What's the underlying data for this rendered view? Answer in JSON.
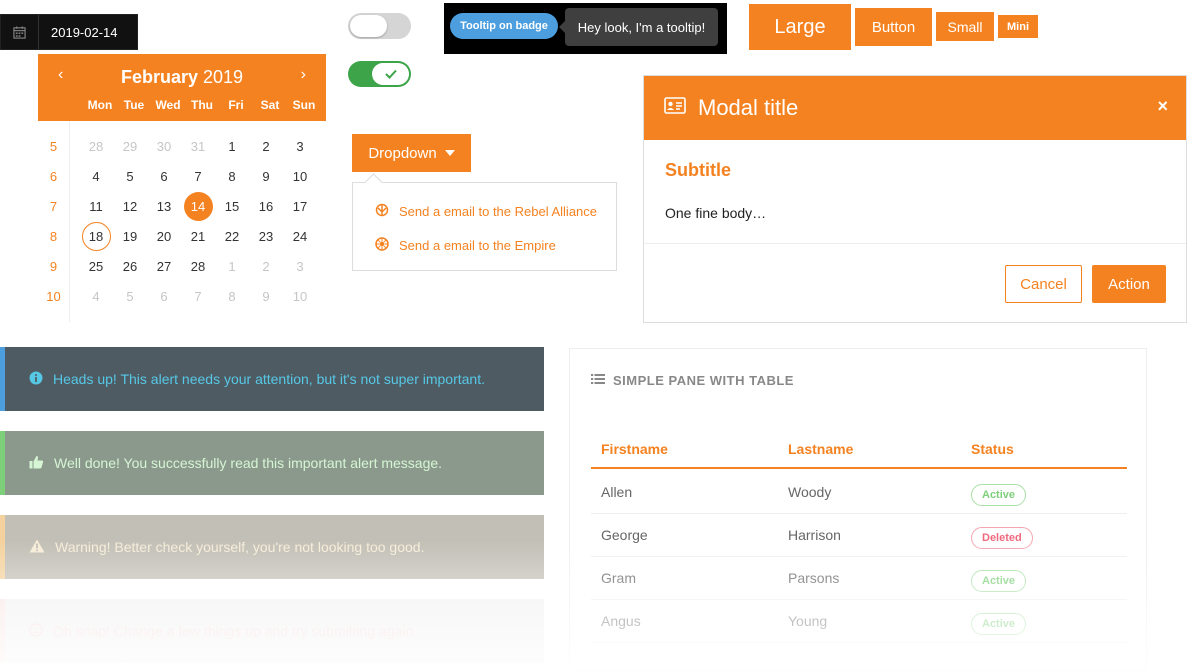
{
  "date_input": {
    "value": "2019-02-14",
    "icon": "calendar-icon"
  },
  "calendar": {
    "month": "February",
    "year": "2019",
    "weekdays": [
      "Mon",
      "Tue",
      "Wed",
      "Thu",
      "Fri",
      "Sat",
      "Sun"
    ],
    "weeks": [
      "5",
      "6",
      "7",
      "8",
      "9",
      "10"
    ],
    "days": [
      "28",
      "29",
      "30",
      "31",
      "1",
      "2",
      "3",
      "4",
      "5",
      "6",
      "7",
      "8",
      "9",
      "10",
      "11",
      "12",
      "13",
      "14",
      "15",
      "16",
      "17",
      "18",
      "19",
      "20",
      "21",
      "22",
      "23",
      "24",
      "25",
      "26",
      "27",
      "28",
      "1",
      "2",
      "3",
      "4",
      "5",
      "6",
      "7",
      "8",
      "9",
      "10"
    ],
    "prev_symbol": "‹",
    "next_symbol": "›"
  },
  "tooltip": {
    "badge_label": "Tooltip on badge",
    "text": "Hey look, I'm a tooltip!"
  },
  "buttons": {
    "large": "Large",
    "normal": "Button",
    "small": "Small",
    "mini": "Mini"
  },
  "dropdown": {
    "label": "Dropdown",
    "items": [
      "Send a email to the Rebel Alliance",
      "Send a email to the Empire"
    ]
  },
  "modal": {
    "title": "Modal title",
    "close": "×",
    "subtitle": "Subtitle",
    "body": "One fine body…",
    "cancel": "Cancel",
    "action": "Action"
  },
  "alerts": {
    "info": "Heads up! This alert needs your attention, but it's not super important.",
    "success": "Well done! You successfully read this important alert message.",
    "warning": "Warning! Better check yourself, you're not looking too good.",
    "danger": "Oh snap! Change a few things up and try submitting again."
  },
  "pane": {
    "title": "SIMPLE PANE WITH TABLE",
    "headers": [
      "Firstname",
      "Lastname",
      "Status"
    ],
    "rows": [
      {
        "first": "Allen",
        "last": "Woody",
        "status": "Active"
      },
      {
        "first": "George",
        "last": "Harrison",
        "status": "Deleted"
      },
      {
        "first": "Gram",
        "last": "Parsons",
        "status": "Active"
      },
      {
        "first": "Angus",
        "last": "Young",
        "status": "Active"
      }
    ]
  },
  "colors": {
    "accent": "#f58220",
    "success": "#3ea44a",
    "info": "#4c9ede",
    "danger": "#f06a7e"
  }
}
